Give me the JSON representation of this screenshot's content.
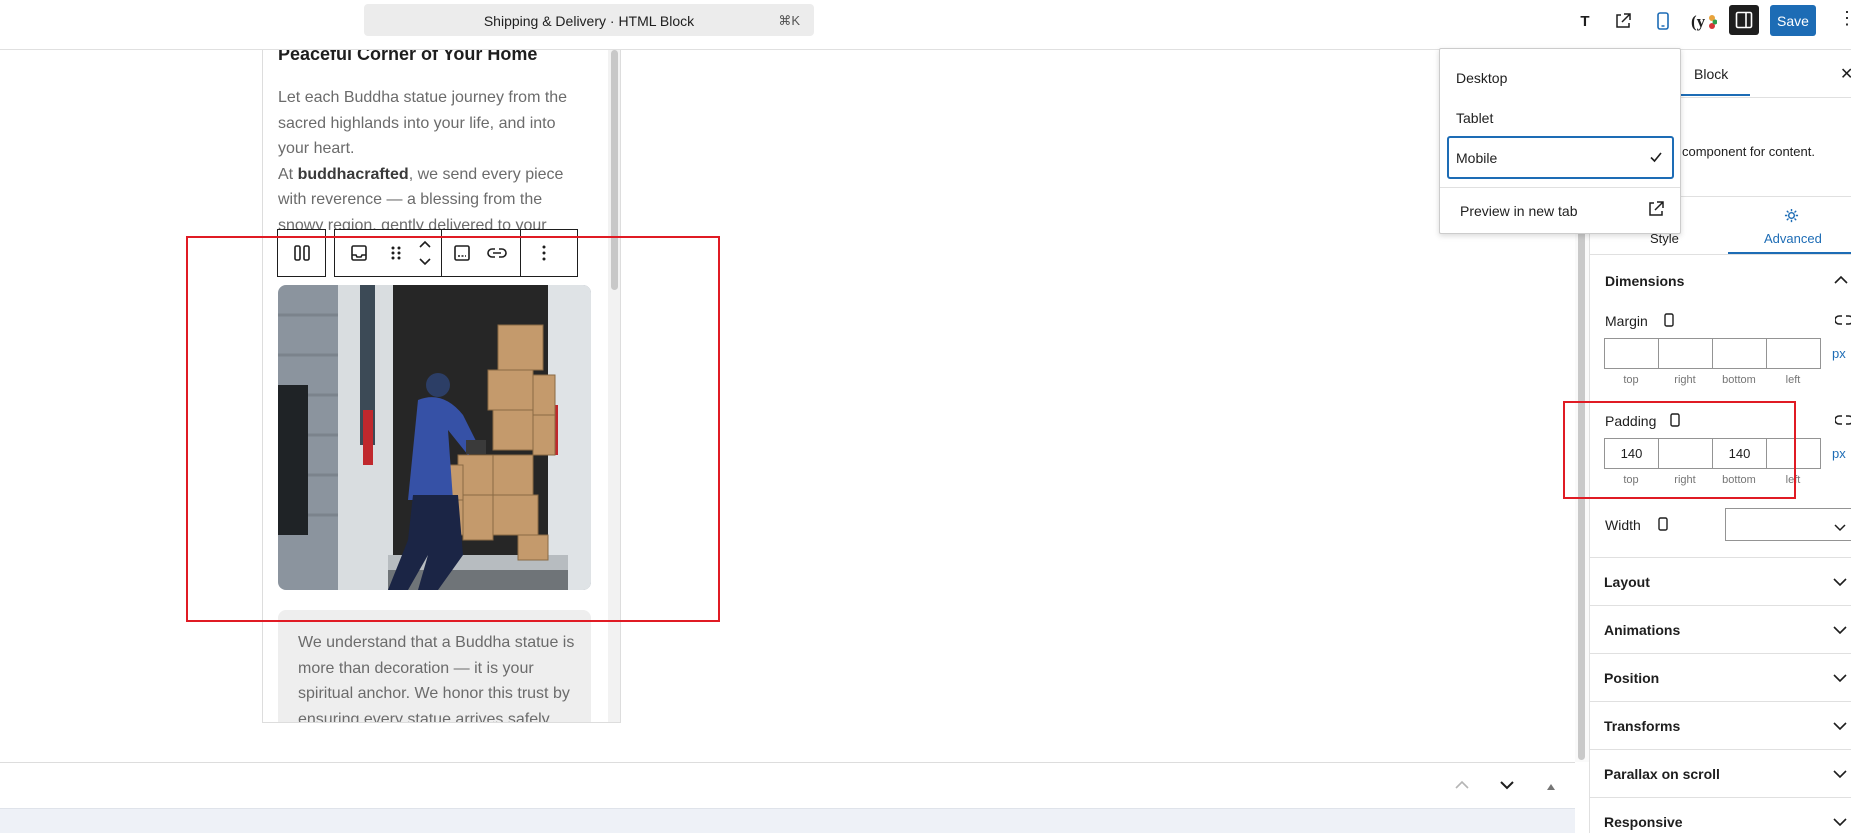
{
  "header": {
    "command_title": "Shipping & Delivery · HTML Block",
    "command_shortcut": "⌘K",
    "save_label": "Save",
    "t_label": "T"
  },
  "device_menu": {
    "items": [
      "Desktop",
      "Tablet",
      "Mobile"
    ],
    "selected": "Mobile",
    "preview_label": "Preview in new tab"
  },
  "content": {
    "heading": "Peaceful Corner of Your Home",
    "para_1": "Let each Buddha statue journey from the sacred highlands into your life, and into your heart.",
    "para_2_prefix": "At ",
    "para_2_bold": "buddhacrafted",
    "para_2_rest": ", we send every piece with reverence — a blessing from the snowy region, gently delivered to your",
    "image_alt": "Delivery worker loading boxes into van",
    "box_text": "We understand that a Buddha statue is more than decoration — it is your spiritual anchor. We honor this trust by ensuring every statue arrives safely"
  },
  "sidebar": {
    "tab_block": "Block",
    "description": "component for content.",
    "subtab_style": "Style",
    "subtab_advanced": "Advanced",
    "dimensions_label": "Dimensions",
    "margin_label": "Margin",
    "padding_label": "Padding",
    "width_label": "Width",
    "unit": "px",
    "margin_values": [
      "",
      "",
      "",
      ""
    ],
    "padding_values": [
      "140",
      "",
      "140",
      ""
    ],
    "side_labels": [
      "top",
      "right",
      "bottom",
      "left"
    ],
    "sections": [
      "Layout",
      "Animations",
      "Position",
      "Transforms",
      "Parallax on scroll",
      "Responsive"
    ]
  },
  "colors": {
    "accent": "#1d6cb5",
    "highlight": "#e01b24"
  }
}
